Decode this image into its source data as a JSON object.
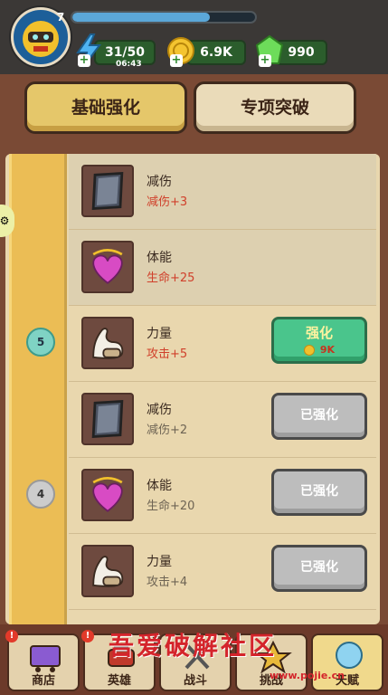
{
  "player": {
    "level": "7",
    "xp_progress": 0.75
  },
  "resources": {
    "energy": "31/50",
    "energy_timer": "06:43",
    "coins": "6.9K",
    "gems": "990"
  },
  "tabs": [
    {
      "label": "基础强化",
      "active": true
    },
    {
      "label": "专项突破",
      "active": false
    }
  ],
  "rail": {
    "nodes": [
      "5",
      "4"
    ]
  },
  "rows": [
    {
      "name": "减伤",
      "bonus": "减伤+3",
      "icon": "armor-plate-icon",
      "state": "locked"
    },
    {
      "name": "体能",
      "bonus": "生命+25",
      "icon": "heart-necklace-icon",
      "state": "locked"
    },
    {
      "name": "力量",
      "bonus": "攻击+5",
      "icon": "muscle-arm-icon",
      "state": "upgrade",
      "button_label": "强化",
      "cost": "9K"
    },
    {
      "name": "减伤",
      "bonus": "减伤+2",
      "icon": "armor-plate-icon",
      "state": "done",
      "button_label": "已强化"
    },
    {
      "name": "体能",
      "bonus": "生命+20",
      "icon": "heart-necklace-icon",
      "state": "done",
      "button_label": "已强化"
    },
    {
      "name": "力量",
      "bonus": "攻击+4",
      "icon": "muscle-arm-icon",
      "state": "done",
      "button_label": "已强化"
    }
  ],
  "bottom_nav": [
    {
      "label": "商店",
      "icon": "shop-cart-icon",
      "alert": true
    },
    {
      "label": "英雄",
      "icon": "hero-icon",
      "alert": true
    },
    {
      "label": "战斗",
      "icon": "battle-icon",
      "alert": false
    },
    {
      "label": "挑战",
      "icon": "challenge-icon",
      "alert": false
    },
    {
      "label": "天赋",
      "icon": "talent-icon",
      "alert": false
    }
  ],
  "watermark": {
    "text": "吾爱破解社区",
    "url": "www.pojie.cn"
  },
  "colors": {
    "upgrade_button": "#4ac58c",
    "done_button": "#bdbdbd",
    "bonus_red": "#d0402b",
    "rail_gold": "#ebbd55"
  }
}
